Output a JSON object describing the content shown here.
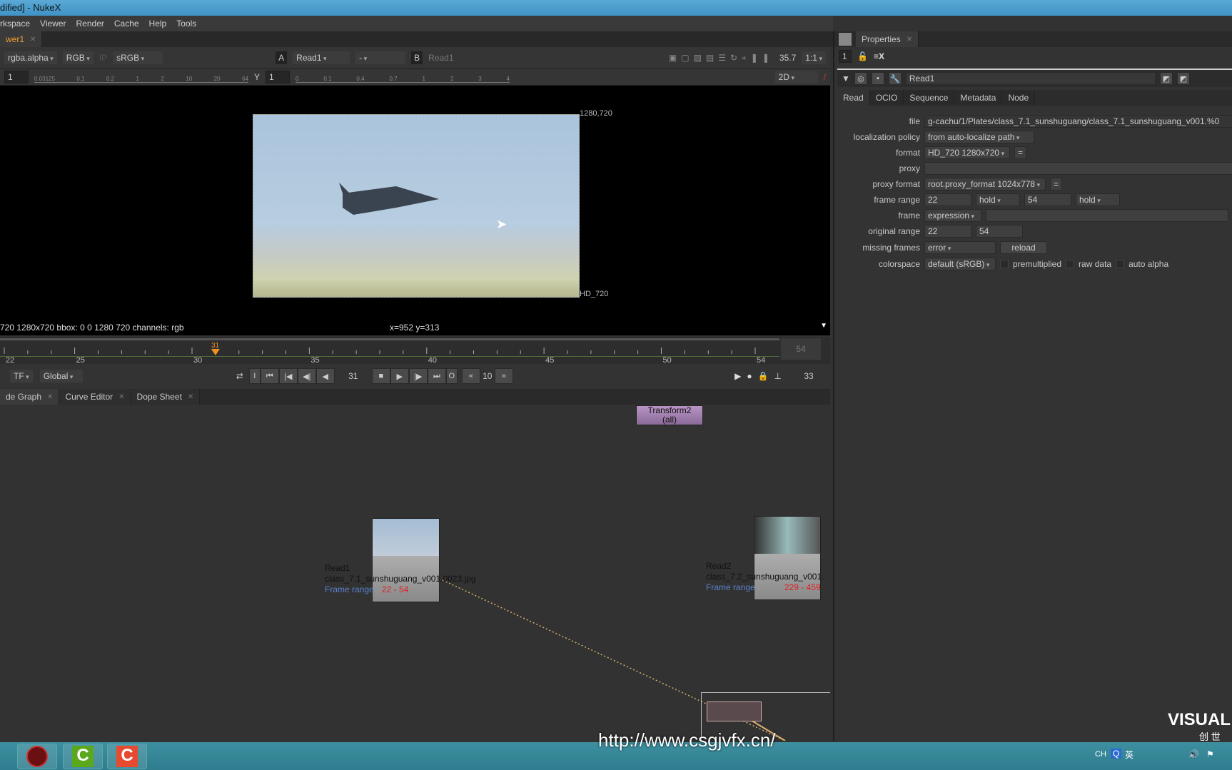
{
  "window": {
    "title": "dified] - NukeX"
  },
  "menu": [
    "rkspace",
    "Viewer",
    "Render",
    "Cache",
    "Help",
    "Tools"
  ],
  "viewer_tab": "wer1",
  "viewer_toolbar": {
    "channels": "rgba.alpha",
    "display": "RGB",
    "ip": "IP",
    "lut": "sRGB",
    "a_label": "A",
    "a_input": "Read1",
    "compare": "-",
    "b_label": "B",
    "b_input": "Read1",
    "zoom": "35.7",
    "ratio": "1:1"
  },
  "viewer_toolbar2": {
    "gain": "1",
    "gain_ticks": [
      "0.03125",
      "0.1",
      "0.2",
      "1",
      "2",
      "10",
      "20",
      "64"
    ],
    "gamma_label": "Y",
    "gamma": "1",
    "gamma_ticks": [
      "0",
      "0.1",
      "0.4",
      "0.7",
      "1",
      "2",
      "3",
      "4"
    ],
    "mode": "2D"
  },
  "viewer": {
    "corner_tr": "1280,720",
    "corner_br": "HD_720"
  },
  "info": {
    "format": "720 1280x720  bbox: 0 0 1280 720 channels: rgb",
    "coords": "x=952 y=313"
  },
  "timeline": {
    "ticks": [
      "22",
      "25",
      "30",
      "35",
      "40",
      "45",
      "50",
      "54"
    ],
    "current": "31",
    "end": "54"
  },
  "controls": {
    "tf": "TF",
    "global": "Global",
    "frame": "31",
    "increment": "10",
    "fps": "33",
    "in": "I",
    "out": "O"
  },
  "bottom_tabs": [
    "de Graph",
    "Curve Editor",
    "Dope Sheet"
  ],
  "nodes": {
    "transform2": {
      "name": "Transform2",
      "sub": "(all)"
    },
    "read1": {
      "name": "Read1",
      "file": "class_7.1_sunshuguang_v001.0023.jpg",
      "range_label": "Frame range",
      "range": "22 - 54"
    },
    "read2": {
      "name": "Read2",
      "file": "class_7.2_sunshuguang_v001.",
      "range_label": "Frame range",
      "range": "229 - 459"
    }
  },
  "properties": {
    "tab": "Properties",
    "count": "1",
    "node_name": "Read1",
    "tabs": [
      "Read",
      "OCIO",
      "Sequence",
      "Metadata",
      "Node"
    ],
    "file": "g-cachu/1/Plates/class_7.1_sunshuguang/class_7.1_sunshuguang_v001.%0",
    "rows": {
      "file": "file",
      "localization": "localization policy",
      "localization_val": "from auto-localize path",
      "format": "format",
      "format_val": "HD_720 1280x720",
      "proxy": "proxy",
      "proxy_format": "proxy format",
      "proxy_format_val": "root.proxy_format 1024x778",
      "frame_range": "frame range",
      "fr_start": "22",
      "fr_before": "hold",
      "fr_end": "54",
      "fr_after": "hold",
      "frame": "frame",
      "frame_val": "expression",
      "original_range": "original range",
      "or_start": "22",
      "or_end": "54",
      "missing": "missing frames",
      "missing_val": "error",
      "reload": "reload",
      "colorspace": "colorspace",
      "colorspace_val": "default (sRGB)",
      "premult": "premultiplied",
      "raw": "raw data",
      "auto_alpha": "auto alpha"
    }
  },
  "watermark": {
    "url": "http://www.csgjvfx.cn/",
    "logo": "VISUAL",
    "logo_sub": "创 世"
  },
  "tray": {
    "lang": "CH",
    "ime": "英"
  }
}
